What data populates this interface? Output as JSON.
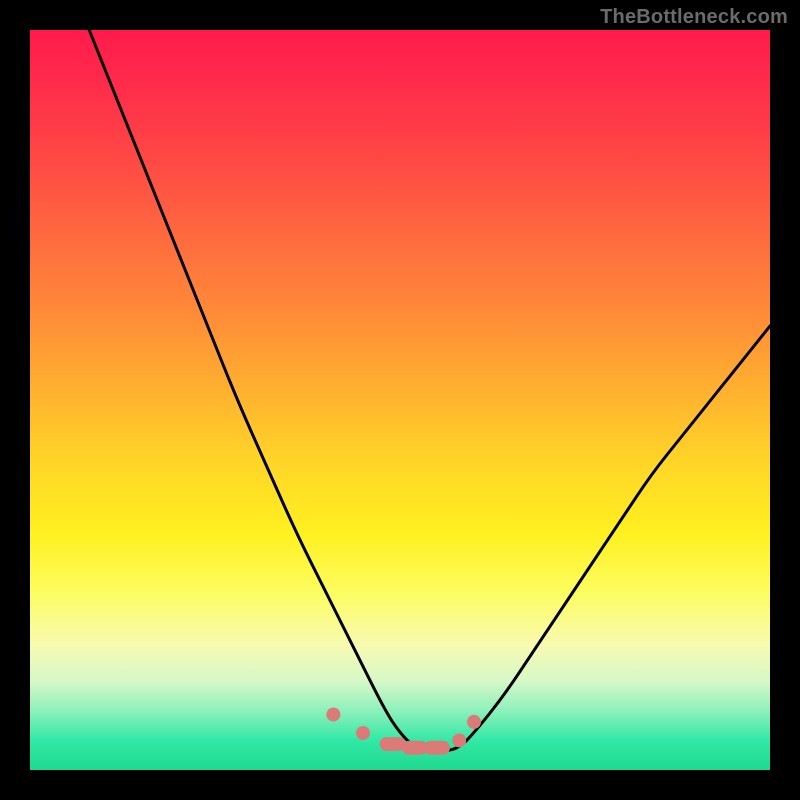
{
  "watermark": "TheBottleneck.com",
  "chart_data": {
    "type": "line",
    "title": "",
    "xlabel": "",
    "ylabel": "",
    "xlim": [
      0,
      100
    ],
    "ylim": [
      0,
      100
    ],
    "series": [
      {
        "name": "bottleneck-curve",
        "color": "#000000",
        "x": [
          8,
          12,
          16,
          20,
          24,
          28,
          32,
          36,
          40,
          44,
          48,
          50,
          52,
          54,
          56,
          58,
          60,
          64,
          68,
          72,
          76,
          80,
          84,
          88,
          92,
          96,
          100
        ],
        "y": [
          100,
          90,
          80,
          70,
          60,
          50,
          41,
          32,
          24,
          16,
          8,
          5,
          3,
          2.5,
          2.5,
          3,
          5,
          10,
          16,
          22,
          28,
          34,
          40,
          45,
          50,
          55,
          60
        ]
      },
      {
        "name": "bottom-markers",
        "color": "#e57373",
        "type": "scatter",
        "x": [
          41,
          45,
          49,
          52,
          55,
          58,
          60
        ],
        "y": [
          7.5,
          5,
          3.5,
          3,
          3,
          4,
          6.5
        ]
      }
    ],
    "background_gradient": {
      "top": "#ff1a4d",
      "mid": "#ffd428",
      "bottom": "#1fd98f"
    }
  }
}
